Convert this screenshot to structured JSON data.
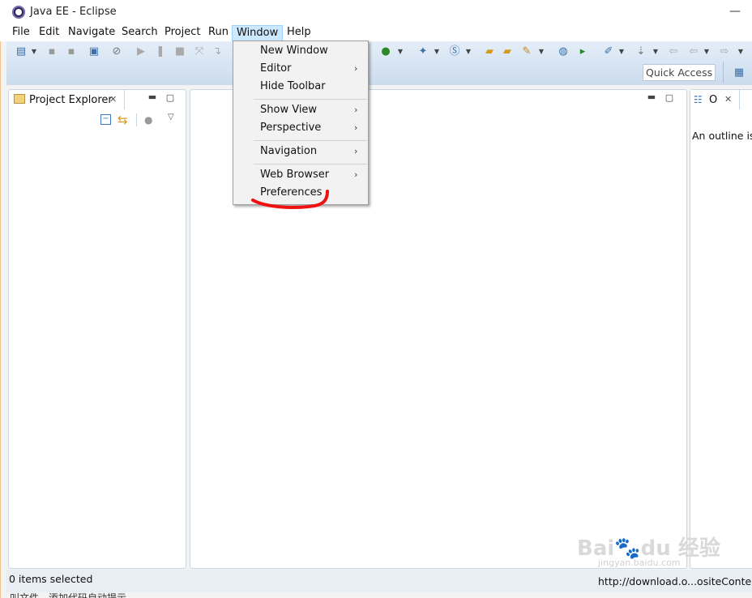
{
  "window": {
    "title": "Java EE - Eclipse"
  },
  "menubar": {
    "items": [
      "File",
      "Edit",
      "Navigate",
      "Search",
      "Project",
      "Run",
      "Window",
      "Help"
    ],
    "active": "Window"
  },
  "window_menu": {
    "items": [
      {
        "label": "New Window",
        "submenu": false
      },
      {
        "label": "Editor",
        "submenu": true
      },
      {
        "label": "Hide Toolbar",
        "submenu": false
      },
      {
        "label": "Show View",
        "submenu": true
      },
      {
        "label": "Perspective",
        "submenu": true
      },
      {
        "label": "Navigation",
        "submenu": true
      },
      {
        "label": "Web Browser",
        "submenu": true
      },
      {
        "label": "Preferences",
        "submenu": false,
        "highlighted_by_annotation": true
      }
    ],
    "submenu_glyph": "›"
  },
  "toolbar": {
    "quick_access_placeholder": "Quick Access"
  },
  "project_explorer": {
    "title": "Project Explorer"
  },
  "outline": {
    "title": "O",
    "message": "An outline is"
  },
  "status": {
    "left": "0 items selected",
    "right": "http://download.o...ositeContent.j"
  },
  "background_fragments": {
    "bottom": "叫文件，添加代码自动提示"
  },
  "watermark": {
    "brand": "Baidu经验",
    "sub": "jingyan.baidu.com"
  },
  "colors": {
    "menu_active_bg": "#cce8ff",
    "toolbar_bg": "#d6e5f4",
    "annotation_red": "#ee1111"
  }
}
